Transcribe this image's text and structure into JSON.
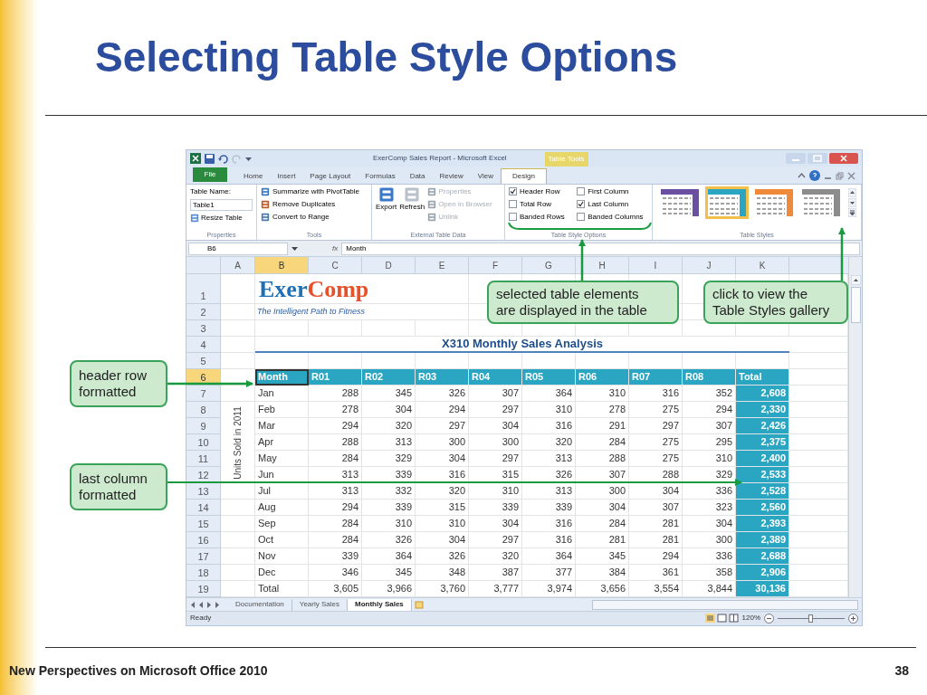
{
  "slide": {
    "title": "Selecting Table Style Options",
    "footer": "New Perspectives on Microsoft Office 2010",
    "page_number": "38"
  },
  "excel": {
    "window_title": "ExerComp Sales Report - Microsoft Excel",
    "context_group": "Table Tools",
    "ribbon_tabs": [
      {
        "label": "File",
        "kind": "file",
        "selected": false
      },
      {
        "label": "Home",
        "kind": "tab",
        "selected": false
      },
      {
        "label": "Insert",
        "kind": "tab",
        "selected": false
      },
      {
        "label": "Page Layout",
        "kind": "tab",
        "selected": false
      },
      {
        "label": "Formulas",
        "kind": "tab",
        "selected": false
      },
      {
        "label": "Data",
        "kind": "tab",
        "selected": false
      },
      {
        "label": "Review",
        "kind": "tab",
        "selected": false
      },
      {
        "label": "View",
        "kind": "tab",
        "selected": false
      },
      {
        "label": "Design",
        "kind": "tab",
        "selected": true
      }
    ],
    "properties": {
      "label": "Properties",
      "name_label": "Table Name:",
      "name_value": "Table1",
      "resize": "Resize Table"
    },
    "tools": {
      "label": "Tools",
      "items": [
        "Summarize with PivotTable",
        "Remove Duplicates",
        "Convert to Range"
      ]
    },
    "external": {
      "label": "External Table Data",
      "large": [
        "Export",
        "Refresh"
      ],
      "small": [
        {
          "label": "Properties",
          "disabled": true
        },
        {
          "label": "Open in Browser",
          "disabled": true
        },
        {
          "label": "Unlink",
          "disabled": true
        }
      ]
    },
    "style_options": {
      "label": "Table Style Options",
      "options": [
        {
          "label": "Header Row",
          "kind": "header_row",
          "checked": true
        },
        {
          "label": "Total Row",
          "kind": "total_row",
          "checked": false
        },
        {
          "label": "Banded Rows",
          "kind": "banded_rows",
          "checked": false
        },
        {
          "label": "First Column",
          "kind": "first_column",
          "checked": false
        },
        {
          "label": "Last Column",
          "kind": "last_column",
          "checked": true
        },
        {
          "label": "Banded Columns",
          "kind": "banded_columns",
          "checked": false
        }
      ]
    },
    "styles": {
      "label": "Table Styles",
      "swatches": [
        {
          "color": "#6b4fa0",
          "selected": false
        },
        {
          "color": "#2aa6c2",
          "selected": true
        },
        {
          "color": "#ef8a3a",
          "selected": false
        },
        {
          "color": "#8c8c8c",
          "selected": false
        }
      ]
    },
    "name_box": "B6",
    "function_symbol": "fx",
    "formula": "Month",
    "column_headers": [
      {
        "label": "A",
        "selected": false
      },
      {
        "label": "B",
        "selected": true
      },
      {
        "label": "C",
        "selected": false
      },
      {
        "label": "D",
        "selected": false
      },
      {
        "label": "E",
        "selected": false
      },
      {
        "label": "F",
        "selected": false
      },
      {
        "label": "G",
        "selected": false
      },
      {
        "label": "H",
        "selected": false
      },
      {
        "label": "I",
        "selected": false
      },
      {
        "label": "J",
        "selected": false
      },
      {
        "label": "K",
        "selected": false
      }
    ],
    "row_headers": [
      {
        "label": "1",
        "selected": false
      },
      {
        "label": "2",
        "selected": false
      },
      {
        "label": "3",
        "selected": false
      },
      {
        "label": "4",
        "selected": false
      },
      {
        "label": "5",
        "selected": false
      },
      {
        "label": "6",
        "selected": true
      },
      {
        "label": "7",
        "selected": false
      },
      {
        "label": "8",
        "selected": false
      },
      {
        "label": "9",
        "selected": false
      },
      {
        "label": "10",
        "selected": false
      },
      {
        "label": "11",
        "selected": false
      },
      {
        "label": "12",
        "selected": false
      },
      {
        "label": "13",
        "selected": false
      },
      {
        "label": "14",
        "selected": false
      },
      {
        "label": "15",
        "selected": false
      },
      {
        "label": "16",
        "selected": false
      },
      {
        "label": "17",
        "selected": false
      },
      {
        "label": "18",
        "selected": false
      },
      {
        "label": "19",
        "selected": false
      }
    ],
    "logo": [
      {
        "text": "Exer",
        "color": "#1f6fb5"
      },
      {
        "text": "Comp",
        "color": "#e8502a"
      }
    ],
    "tagline": "The Intelligent Path to Fitness",
    "sheet_title": "X310 Monthly Sales Analysis",
    "side_label": "Units Sold in 2011",
    "table": {
      "columns": [
        "Month",
        "R01",
        "R02",
        "R03",
        "R04",
        "R05",
        "R06",
        "R07",
        "R08",
        "Total"
      ],
      "rows": [
        [
          "Jan",
          "288",
          "345",
          "326",
          "307",
          "364",
          "310",
          "316",
          "352",
          "2,608"
        ],
        [
          "Feb",
          "278",
          "304",
          "294",
          "297",
          "310",
          "278",
          "275",
          "294",
          "2,330"
        ],
        [
          "Mar",
          "294",
          "320",
          "297",
          "304",
          "316",
          "291",
          "297",
          "307",
          "2,426"
        ],
        [
          "Apr",
          "288",
          "313",
          "300",
          "300",
          "320",
          "284",
          "275",
          "295",
          "2,375"
        ],
        [
          "May",
          "284",
          "329",
          "304",
          "297",
          "313",
          "288",
          "275",
          "310",
          "2,400"
        ],
        [
          "Jun",
          "313",
          "339",
          "316",
          "315",
          "326",
          "307",
          "288",
          "329",
          "2,533"
        ],
        [
          "Jul",
          "313",
          "332",
          "320",
          "310",
          "313",
          "300",
          "304",
          "336",
          "2,528"
        ],
        [
          "Aug",
          "294",
          "339",
          "315",
          "339",
          "339",
          "304",
          "307",
          "323",
          "2,560"
        ],
        [
          "Sep",
          "284",
          "310",
          "310",
          "304",
          "316",
          "284",
          "281",
          "304",
          "2,393"
        ],
        [
          "Oct",
          "284",
          "326",
          "304",
          "297",
          "316",
          "281",
          "281",
          "300",
          "2,389"
        ],
        [
          "Nov",
          "339",
          "364",
          "326",
          "320",
          "364",
          "345",
          "294",
          "336",
          "2,688"
        ],
        [
          "Dec",
          "346",
          "345",
          "348",
          "387",
          "377",
          "384",
          "361",
          "358",
          "2,906"
        ],
        [
          "Total",
          "3,605",
          "3,966",
          "3,760",
          "3,777",
          "3,974",
          "3,656",
          "3,554",
          "3,844",
          "30,136"
        ]
      ]
    },
    "sheet_tabs": [
      {
        "label": "Documentation",
        "selected": false
      },
      {
        "label": "Yearly Sales",
        "selected": false
      },
      {
        "label": "Monthly Sales",
        "selected": true
      }
    ],
    "status": "Ready",
    "zoom": "120%",
    "zoom_slider": {
      "level": 0.5
    }
  },
  "callouts": [
    {
      "lines": [
        "header row",
        "formatted"
      ]
    },
    {
      "lines": [
        "last column",
        "formatted"
      ]
    },
    {
      "lines": [
        "selected table elements",
        "are displayed in the table"
      ]
    },
    {
      "lines": [
        "click to view the",
        "Table Styles gallery"
      ]
    }
  ]
}
